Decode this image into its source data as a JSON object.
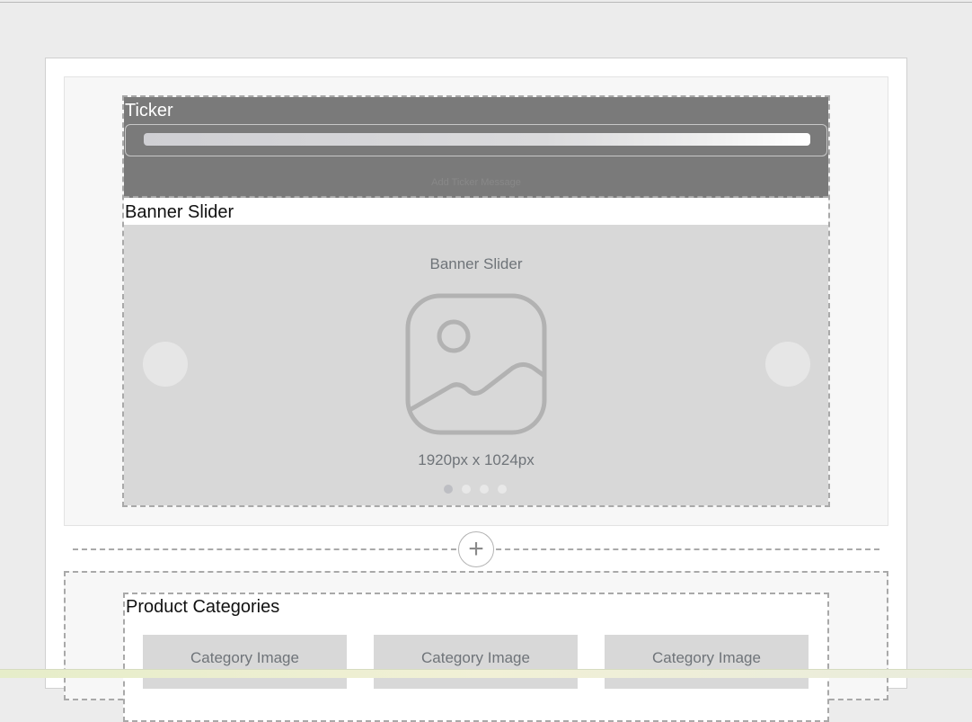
{
  "ticker": {
    "title": "Ticker",
    "faint_text": "Add Ticker Message"
  },
  "banner_slider": {
    "title": "Banner Slider",
    "caption": "Banner Slider",
    "size_label": "1920px x 1024px",
    "icon": "image-placeholder-icon",
    "dots_total": 4,
    "active_dot": 0
  },
  "add_section": {
    "icon": "plus-icon",
    "glyph": "+"
  },
  "product_categories": {
    "title": "Product Categories",
    "cards": [
      {
        "label": "Category Image"
      },
      {
        "label": "Category Image"
      },
      {
        "label": "Category Image"
      }
    ]
  },
  "colors": {
    "page_bg": "#ececec",
    "ticker_bg": "#7a7a7a",
    "placeholder_bg": "#d8d8d8",
    "dashed_border": "#a9a9a9",
    "muted_text": "#6f7479"
  }
}
